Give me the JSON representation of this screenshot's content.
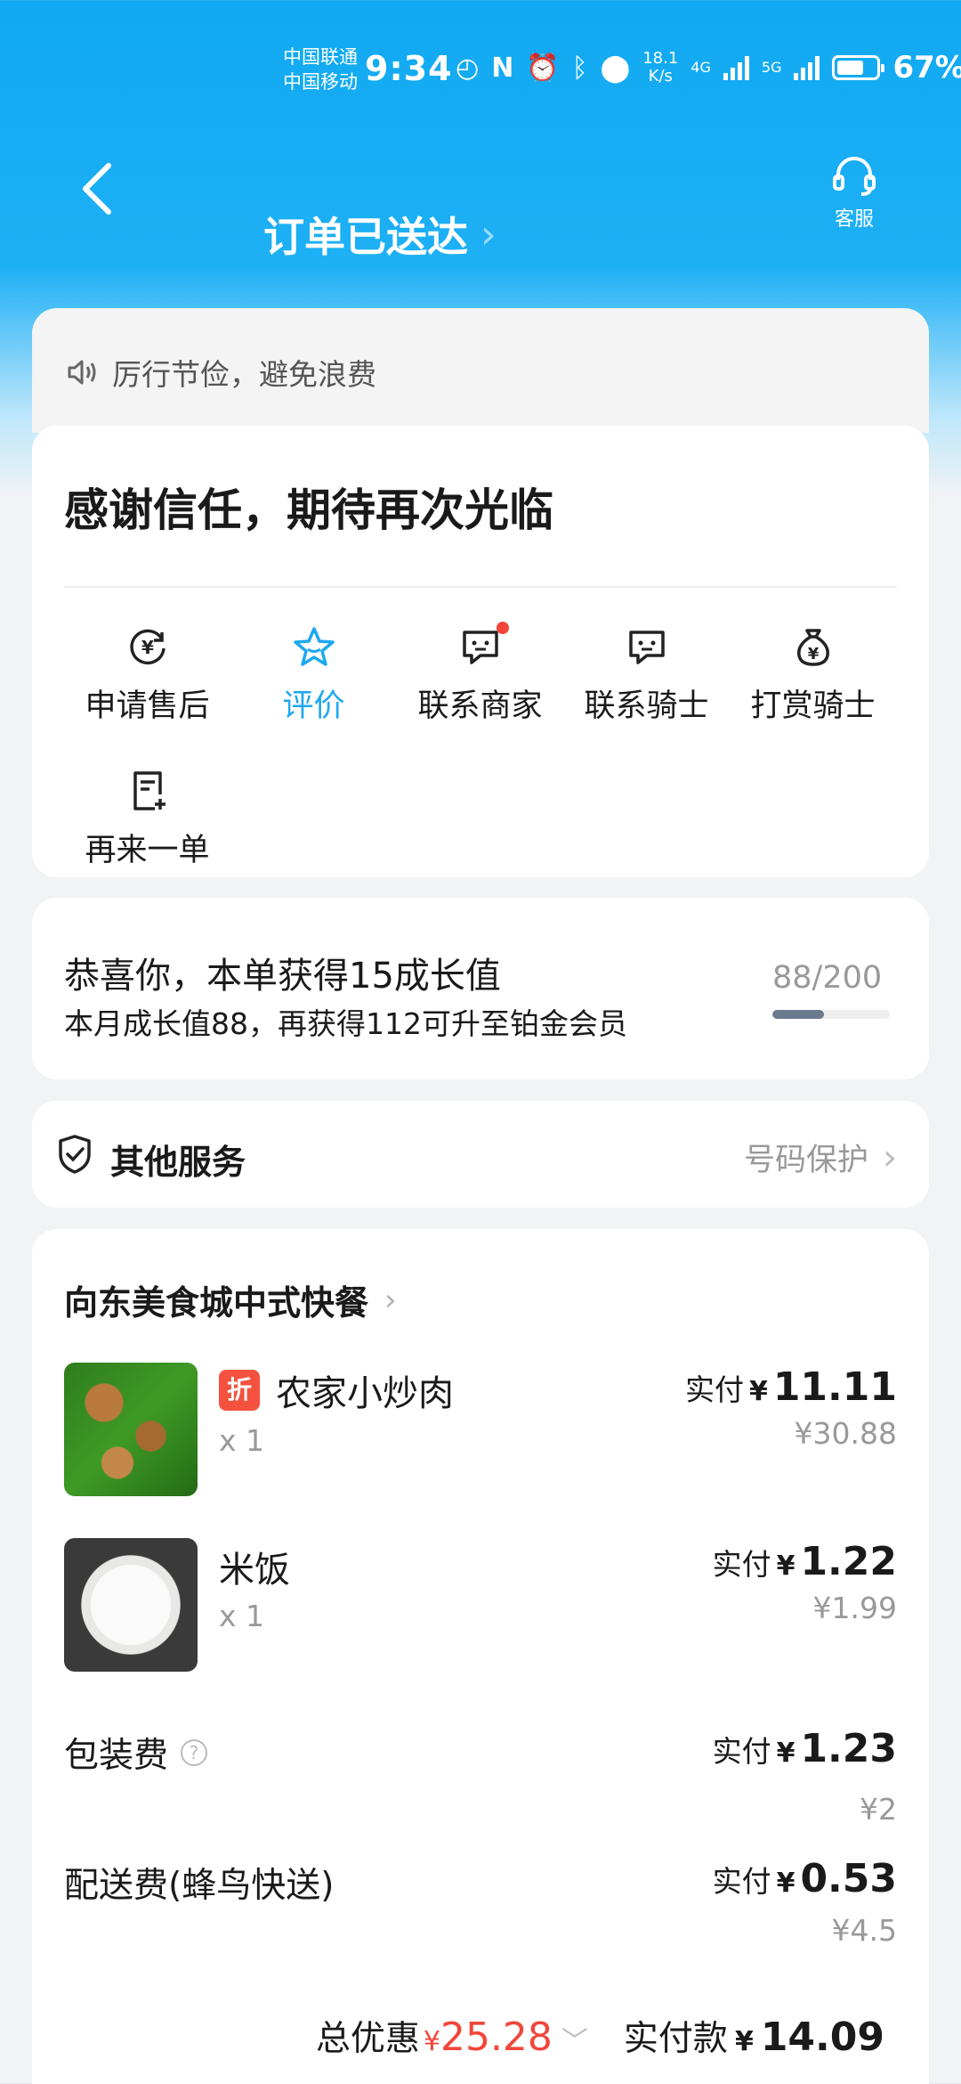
{
  "status_bar": {
    "carrier1": "中国联通",
    "carrier2": "中国移动",
    "time": "9:34",
    "net_speed_value": "18.1",
    "net_speed_unit": "K/s",
    "sig1": "4G",
    "sig2": "5G",
    "battery": "67%",
    "battery_level": 0.67
  },
  "header": {
    "title": "订单已送达",
    "service_label": "客服"
  },
  "notice": "厉行节俭，避免浪费",
  "thanks": "感谢信任，期待再次光临",
  "actions": [
    {
      "label": "申请售后",
      "icon": "refund-icon"
    },
    {
      "label": "评价",
      "icon": "star-icon"
    },
    {
      "label": "联系商家",
      "icon": "chat-icon"
    },
    {
      "label": "联系骑士",
      "icon": "chat-icon"
    },
    {
      "label": "打赏骑士",
      "icon": "money-bag-icon"
    },
    {
      "label": "再来一单",
      "icon": "reorder-icon"
    }
  ],
  "growth": {
    "line1": "恭喜你，本单获得15成长值",
    "line2": "本月成长值88，再获得112可升至铂金会员",
    "progress_text": "88/200",
    "progress": 0.44
  },
  "other_services": {
    "title": "其他服务",
    "right": "号码保护"
  },
  "order": {
    "shop": "向东美食城中式快餐",
    "items": [
      {
        "name": "农家小炒肉",
        "badge": "折",
        "qty": "x 1",
        "paid_label": "实付",
        "currency": "¥",
        "paid": "11.11",
        "original": "¥30.88"
      },
      {
        "name": "米饭",
        "qty": "x 1",
        "paid_label": "实付",
        "currency": "¥",
        "paid": "1.22",
        "original": "¥1.99"
      }
    ],
    "packaging": {
      "label": "包装费",
      "paid_label": "实付",
      "currency": "¥",
      "paid": "1.23",
      "original": "¥2"
    },
    "delivery": {
      "label": "配送费(蜂鸟快送)",
      "paid_label": "实付",
      "currency": "¥",
      "paid": "0.53",
      "original": "¥4.5"
    },
    "total_discount_label": "总优惠",
    "total_discount_currency": "¥",
    "total_discount": "25.28",
    "total_paid_label": "实付款",
    "total_currency": "¥",
    "total_paid": "14.09"
  },
  "colors": {
    "brand": "#1ea8ef",
    "red": "#f2463a"
  }
}
